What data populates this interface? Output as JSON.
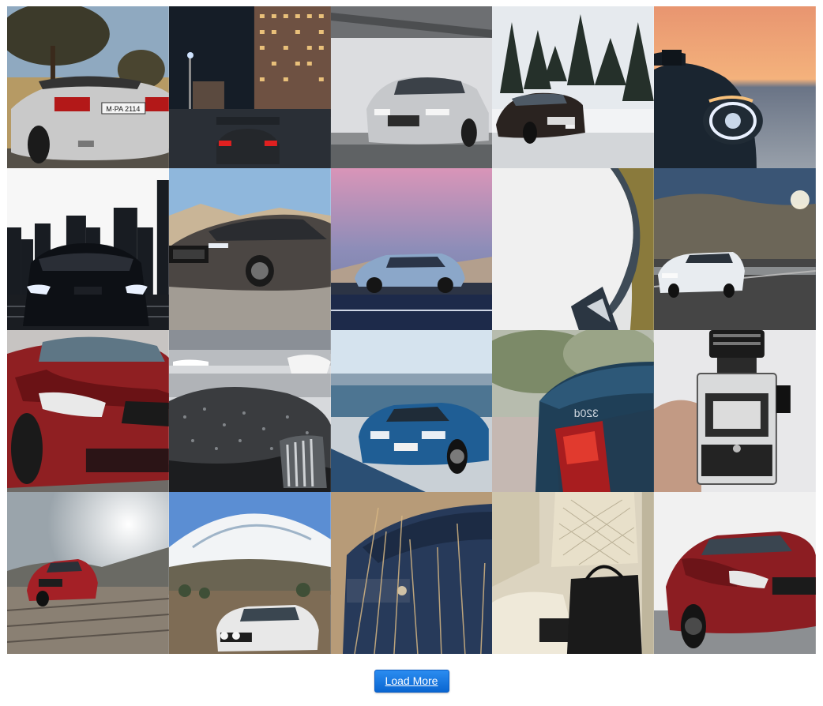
{
  "gallery": {
    "images": [
      {
        "subject": "silver convertible rear view under trees"
      },
      {
        "subject": "car in parking garage with city towers at night"
      },
      {
        "subject": "white sedan front view under bridge"
      },
      {
        "subject": "dark SUV in snowy forest"
      },
      {
        "subject": "headlight close-up at sunset"
      },
      {
        "subject": "black car front silhouette with city skyline"
      },
      {
        "subject": "dark grey luxury sedan side view"
      },
      {
        "subject": "blue SUV at dusk with pink sky"
      },
      {
        "subject": "abstract car body close-up"
      },
      {
        "subject": "white sedan on mountain road"
      },
      {
        "subject": "red coupe front close-up"
      },
      {
        "subject": "wet car hood at airport with jets"
      },
      {
        "subject": "blue sedan by the harbor"
      },
      {
        "subject": "dark car rear with 320d badge"
      },
      {
        "subject": "hand holding vintage medium format camera"
      },
      {
        "subject": "red SUV drifting on dirt road"
      },
      {
        "subject": "white classic sedan near snowy mountain"
      },
      {
        "subject": "blue car behind dry grass"
      },
      {
        "subject": "cream leather interior with black bag"
      },
      {
        "subject": "red coupe front three-quarter view"
      }
    ],
    "badge_text": {
      "plate_1": "M·PA 2114",
      "plate_14": "320d"
    }
  },
  "load_more": {
    "label": "Load More"
  },
  "colors": {
    "button_top": "#2b8cf0",
    "button_bottom": "#0a66d1",
    "button_border": "#0b5cc4"
  }
}
